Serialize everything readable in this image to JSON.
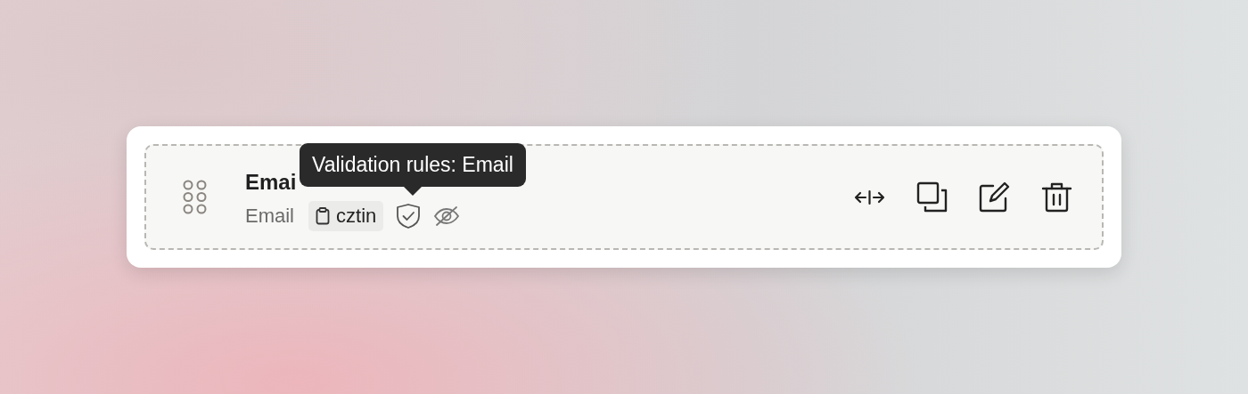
{
  "field": {
    "title": "Emai",
    "type_label": "Email",
    "key_chip": "cztin"
  },
  "tooltip": {
    "text": "Validation rules: Email"
  }
}
